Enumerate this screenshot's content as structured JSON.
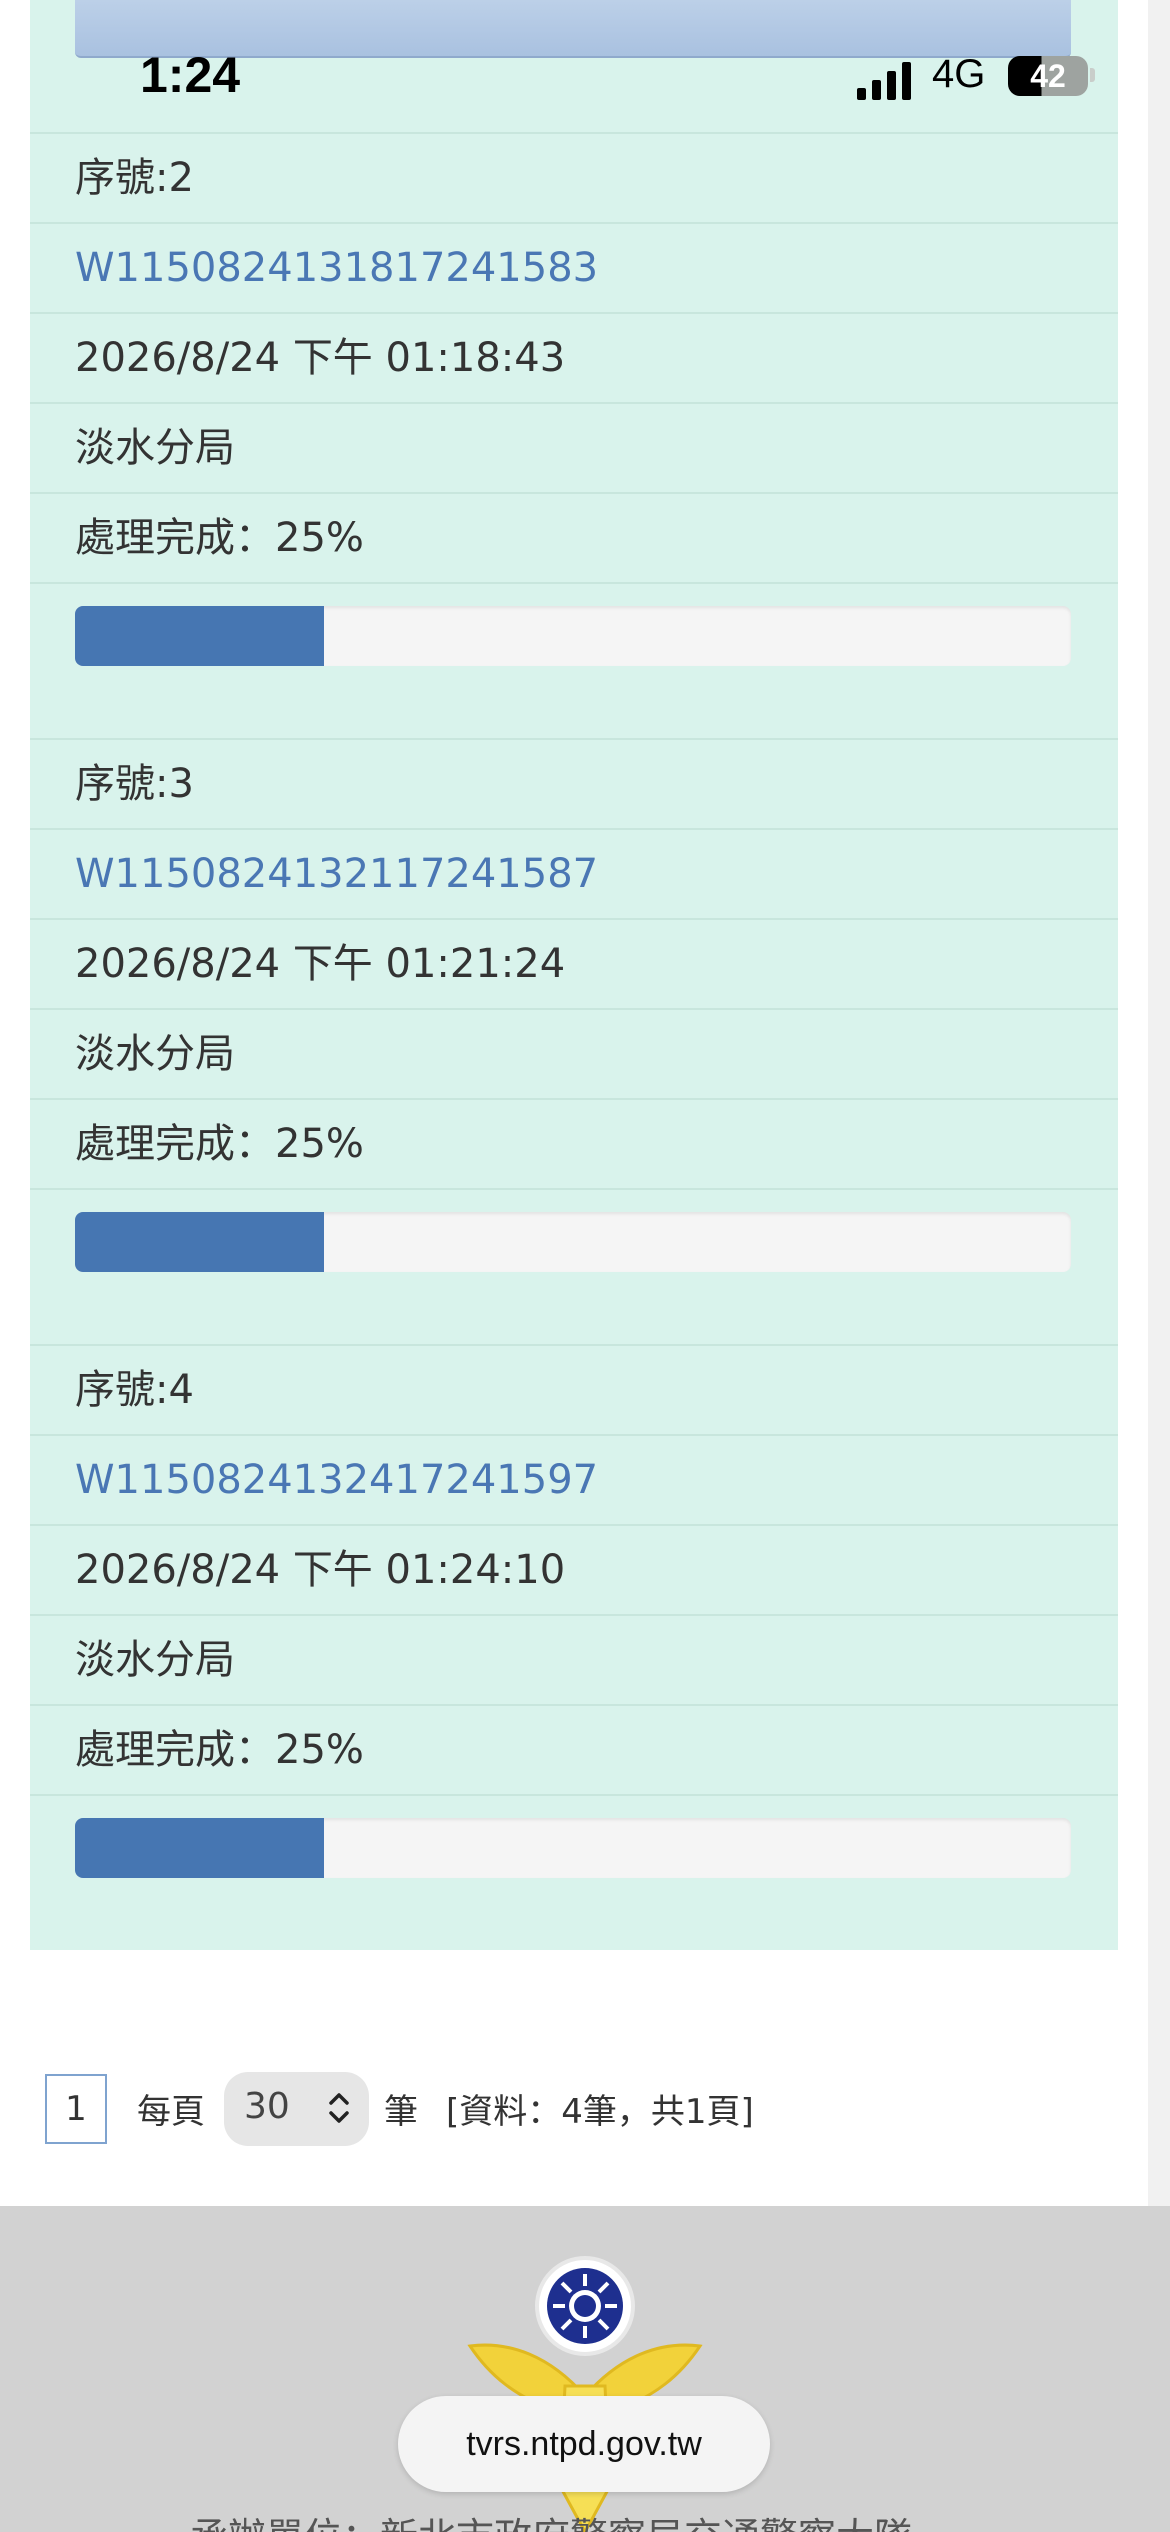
{
  "status_bar": {
    "time": "1:24",
    "network": "4G",
    "battery": "42"
  },
  "records": [
    {
      "serial_label": "序號:2",
      "case_id": "W1150824131817241583",
      "datetime": "2026/8/24 下午 01:18:43",
      "unit": "淡水分局",
      "status": "處理完成：25%",
      "progress_percent": 25
    },
    {
      "serial_label": "序號:3",
      "case_id": "W1150824132117241587",
      "datetime": "2026/8/24 下午 01:21:24",
      "unit": "淡水分局",
      "status": "處理完成：25%",
      "progress_percent": 25
    },
    {
      "serial_label": "序號:4",
      "case_id": "W1150824132417241597",
      "datetime": "2026/8/24 下午 01:24:10",
      "unit": "淡水分局",
      "status": "處理完成：25%",
      "progress_percent": 25
    }
  ],
  "pagination": {
    "current_page": "1",
    "per_page_label": "每頁",
    "page_size": "30",
    "unit_label": "筆",
    "summary": "[資料：4筆，共1頁]"
  },
  "footer": {
    "url": "tvrs.ntpd.gov.tw",
    "text": "承辦單位：新北市政府警察局交通警察大隊"
  },
  "colors": {
    "panel_bg": "#d9f3ec",
    "link": "#4a77b4",
    "progress_fill": "#4676b2",
    "footer_bg": "#d2d2d2"
  }
}
